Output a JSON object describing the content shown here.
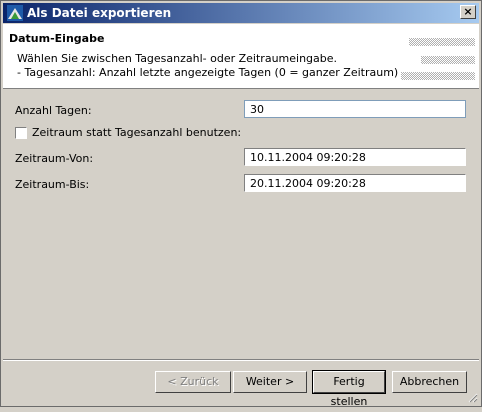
{
  "window": {
    "title": "Als Datei exportieren",
    "close_glyph": "×",
    "icon": "app-export-icon"
  },
  "header": {
    "title": "Datum-Eingabe",
    "desc_line1": "Wählen Sie zwischen Tagesanzahl- oder Zeitraumeingabe.",
    "desc_line2": "- Tagesanzahl: Anzahl letzte angezeigte Tagen (0 = ganzer Zeitraum)"
  },
  "form": {
    "anzahl_tagen_label": "Anzahl Tagen:",
    "anzahl_tagen_value": "30",
    "zeitraum_checkbox_label": "Zeitraum statt Tagesanzahl benutzen:",
    "zeitraum_checkbox_checked": false,
    "zeitraum_von_label": "Zeitraum-Von:",
    "zeitraum_von_value": "10.11.2004 09:20:28",
    "zeitraum_bis_label": "Zeitraum-Bis:",
    "zeitraum_bis_value": "20.11.2004 09:20:28"
  },
  "buttons": {
    "back": "< Zurück",
    "next": "Weiter >",
    "finish": "Fertig stellen",
    "cancel": "Abbrechen"
  },
  "colors": {
    "titlebar_start": "#0a246a",
    "titlebar_end": "#a6caf0",
    "face": "#d4d0c8"
  }
}
